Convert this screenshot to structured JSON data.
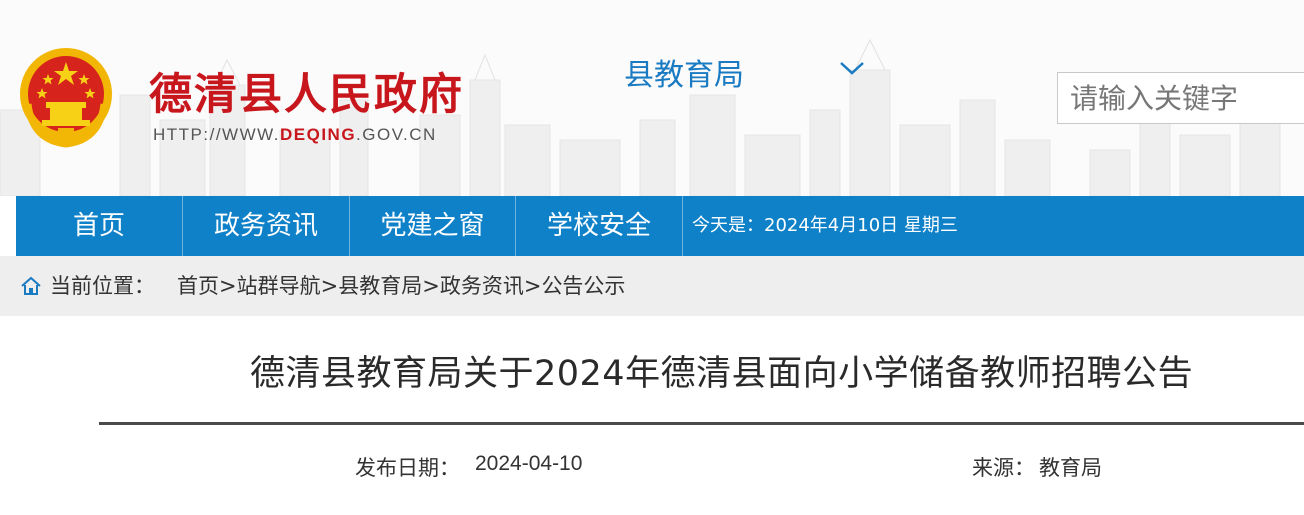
{
  "header": {
    "site_title": "德清县人民政府",
    "site_url_prefix": "HTTP://WWW.",
    "site_url_highlight": "DEQING",
    "site_url_suffix": ".GOV.CN",
    "station": "县教育局",
    "search_placeholder": "请输入关键字",
    "brand_color": "#c8161d",
    "accent_color": "#1a7ac2"
  },
  "nav": {
    "items": [
      {
        "label": "首页"
      },
      {
        "label": "政务资讯"
      },
      {
        "label": "党建之窗"
      },
      {
        "label": "学校安全"
      }
    ],
    "date_text": "今天是：2024年4月10日 星期三",
    "bar_color": "#0f81c8"
  },
  "breadcrumb": {
    "label": "当前位置：",
    "items": [
      "首页",
      "站群导航",
      "县教育局",
      "政务资讯",
      "公告公示"
    ],
    "separator": ">",
    "icon": "home-icon"
  },
  "article": {
    "title": "德清县教育局关于2024年德清县面向小学储备教师招聘公告",
    "date_label": "发布日期：",
    "date": "2024-04-10",
    "source_label": "来源：",
    "source": "教育局"
  }
}
